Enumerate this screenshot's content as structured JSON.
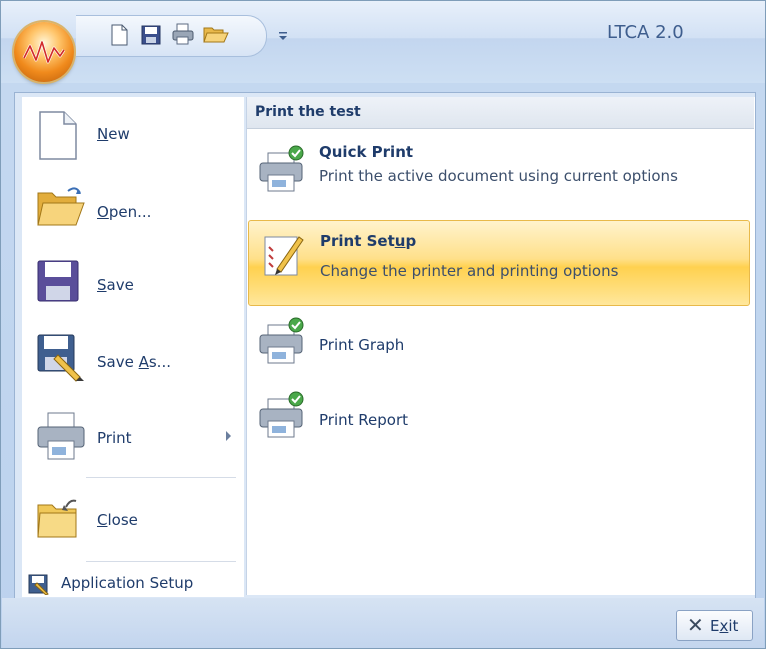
{
  "app": {
    "title": "LTCA 2.0"
  },
  "quick_access": {
    "items": [
      "new-document-icon",
      "save-icon",
      "print-icon",
      "open-folder-icon"
    ],
    "dropdown": "customize-toolbar-dropdown"
  },
  "left_menu": {
    "items": [
      {
        "label_pre": "",
        "label_u": "N",
        "label_post": "ew",
        "icon": "new-document-icon"
      },
      {
        "label_pre": "",
        "label_u": "O",
        "label_post": "pen...",
        "icon": "open-folder-icon"
      },
      {
        "label_pre": "",
        "label_u": "S",
        "label_post": "ave",
        "icon": "save-icon"
      },
      {
        "label_pre": "Save ",
        "label_u": "A",
        "label_post": "s...",
        "icon": "save-as-icon"
      },
      {
        "label_pre": "Print",
        "label_u": "",
        "label_post": "",
        "icon": "printer-icon"
      },
      {
        "label_pre": "",
        "label_u": "C",
        "label_post": "lose",
        "icon": "close-folder-icon"
      }
    ],
    "application_setup": "Application Setup"
  },
  "print_submenu": {
    "header": "Print the test",
    "items": [
      {
        "title": "Quick Print",
        "title_u": "",
        "description": "Print the active document using current options",
        "icon": "quick-print-icon"
      },
      {
        "title_pre": "Print Set",
        "title_u": "u",
        "title_post": "p",
        "description": "Change the printer and printing options",
        "icon": "print-setup-icon",
        "highlighted": true
      },
      {
        "title": "Print Graph",
        "icon": "print-graph-icon"
      },
      {
        "title": "Print Report",
        "icon": "print-report-icon"
      }
    ]
  },
  "footer": {
    "exit_pre": "E",
    "exit_u": "x",
    "exit_post": "it"
  }
}
